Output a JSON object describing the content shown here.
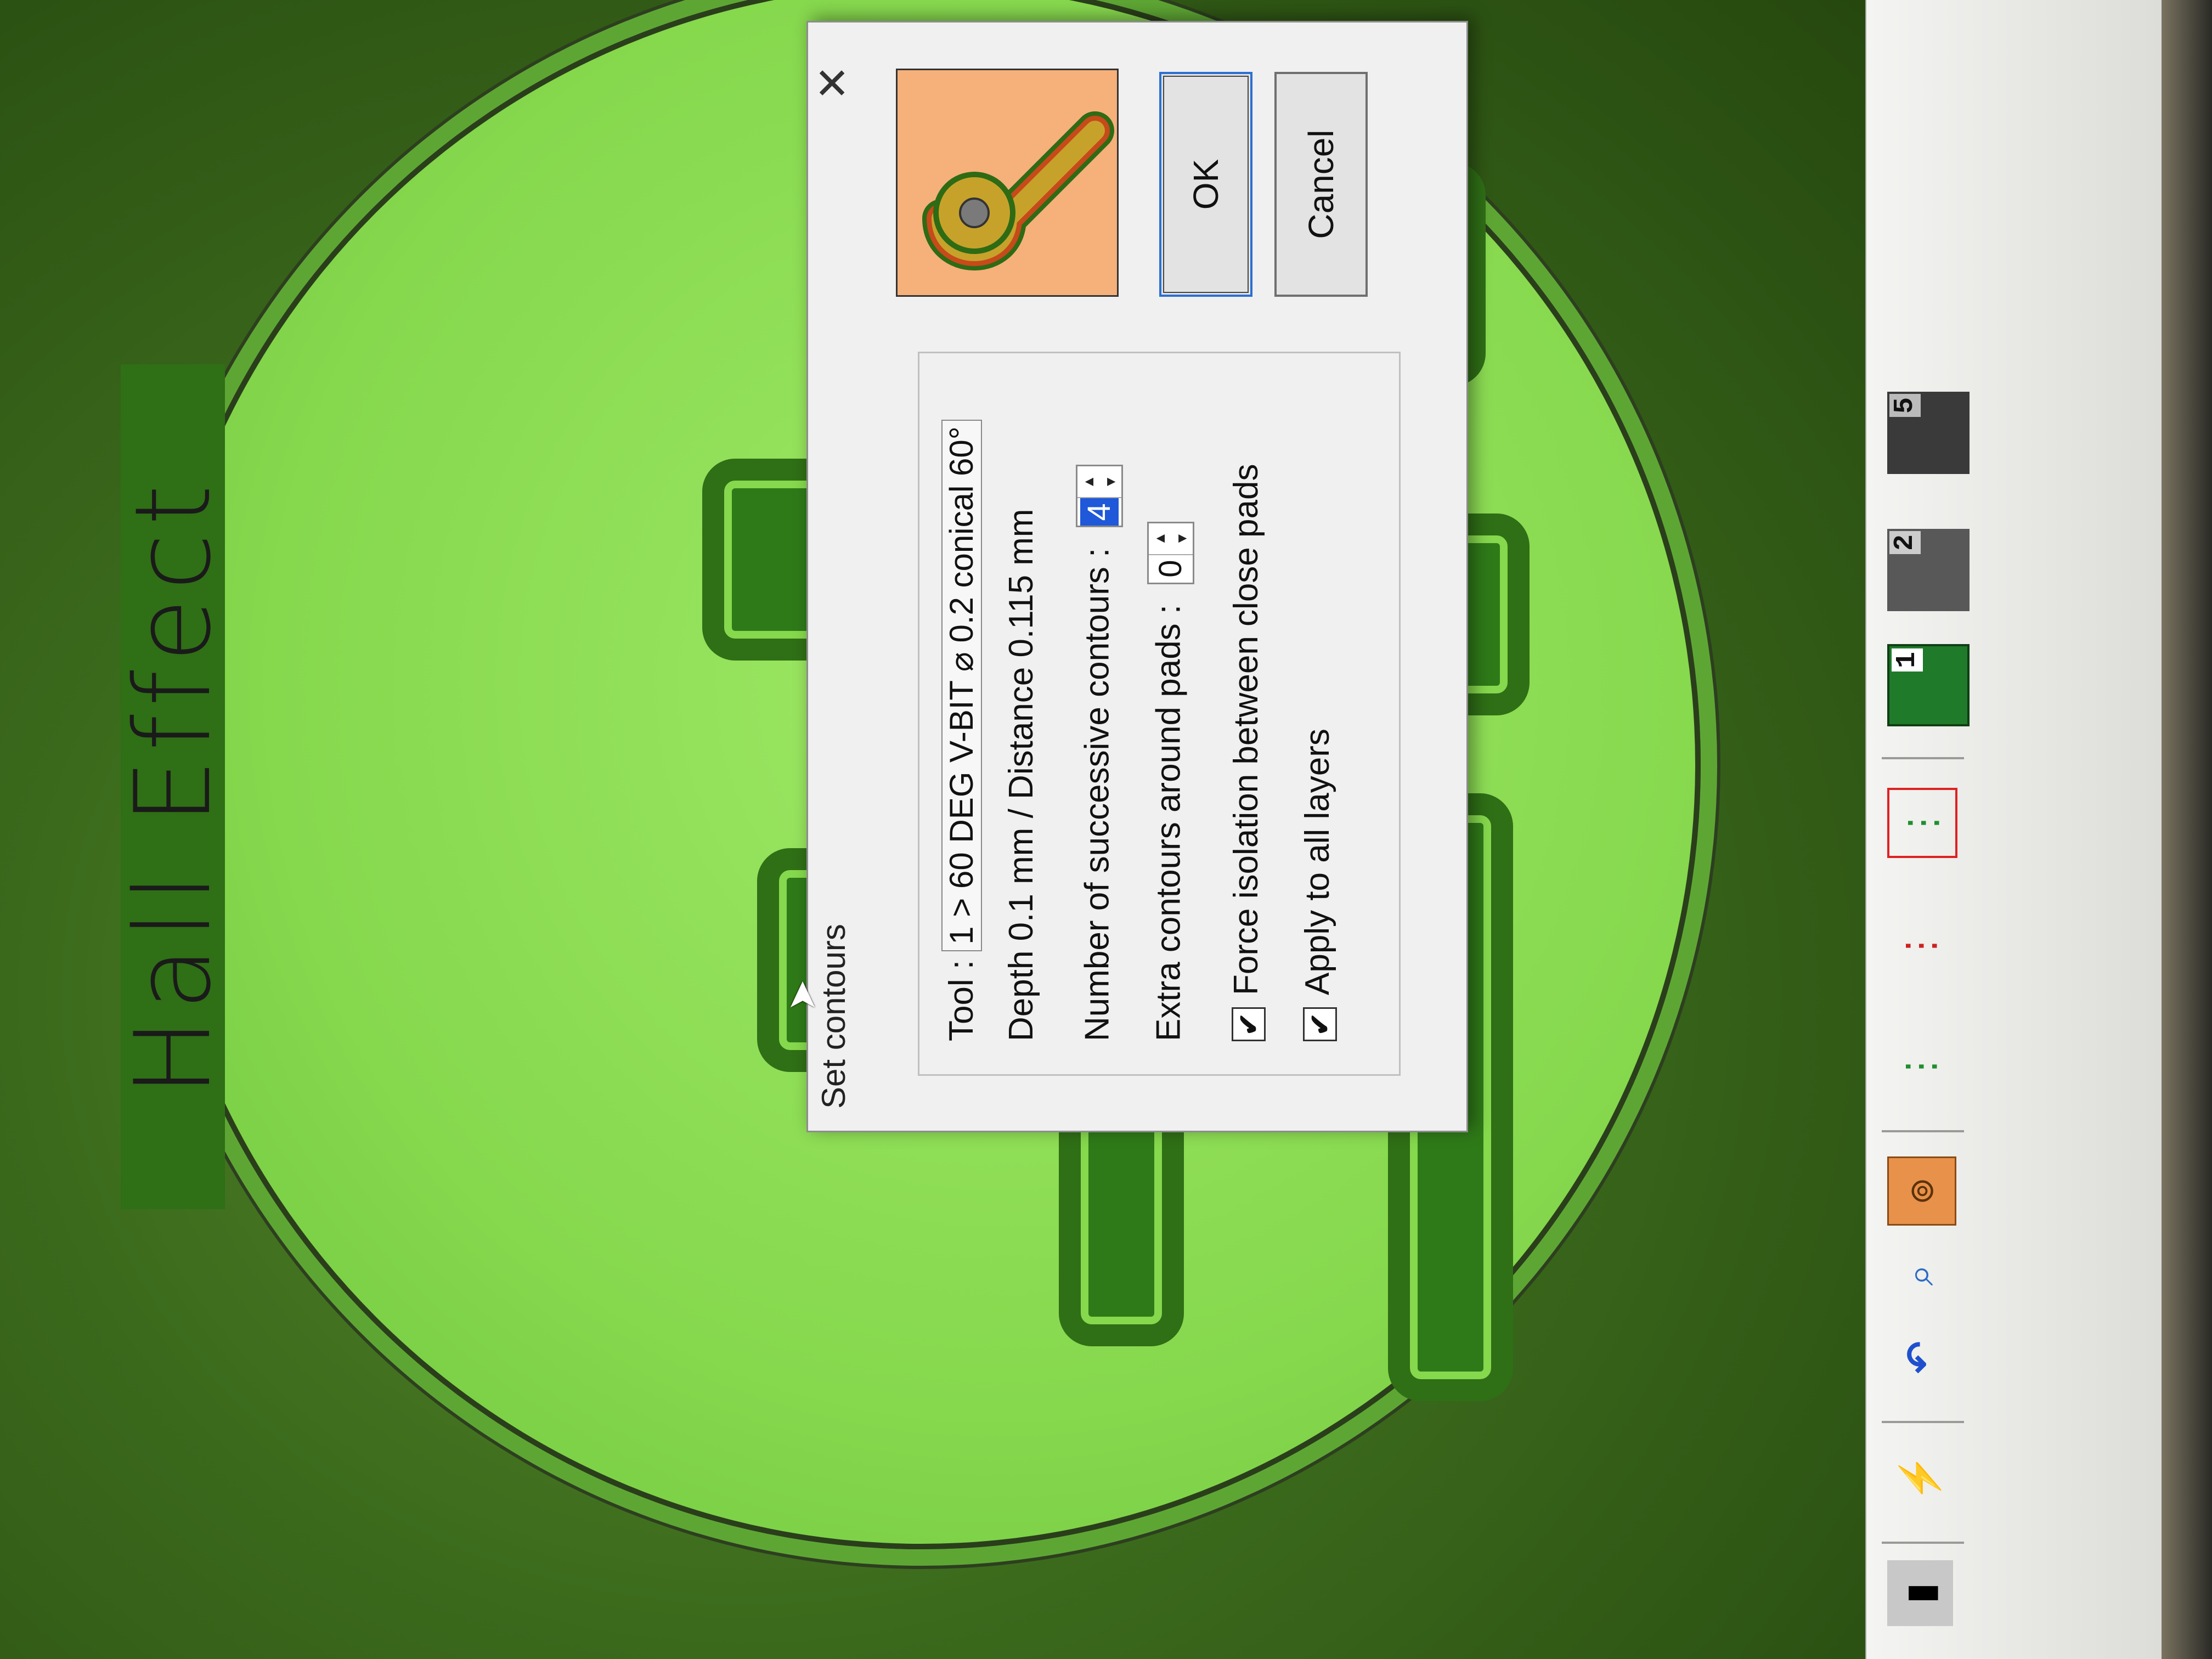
{
  "dialog": {
    "title": "Set contours",
    "close_glyph": "✕",
    "tool_label": "Tool :",
    "tool_value": "1 > 60 DEG V-BIT   ⌀ 0.2   conical 60°",
    "depth_text": "Depth 0.1 mm  /  Distance 0.115 mm",
    "successive_label": "Number of successive contours :",
    "successive_value": "4",
    "extra_label": "Extra contours around pads :",
    "extra_value": "0",
    "force_label": "Force isolation between close pads",
    "force_checked": true,
    "apply_label": "Apply to all layers",
    "apply_checked": true,
    "ok_label": "OK",
    "cancel_label": "Cancel"
  },
  "toolbar": {
    "layers": [
      {
        "number": "1",
        "active": true
      },
      {
        "number": "2",
        "active": false
      },
      {
        "number": "5",
        "active": false
      }
    ]
  },
  "board": {
    "silkscreen_text": "Hall Effect"
  },
  "colors": {
    "board_green": "#86d84d",
    "copper_dark": "#2f6f16",
    "preview_copper": "#f6b07a",
    "selection_blue": "#1f58d8"
  }
}
